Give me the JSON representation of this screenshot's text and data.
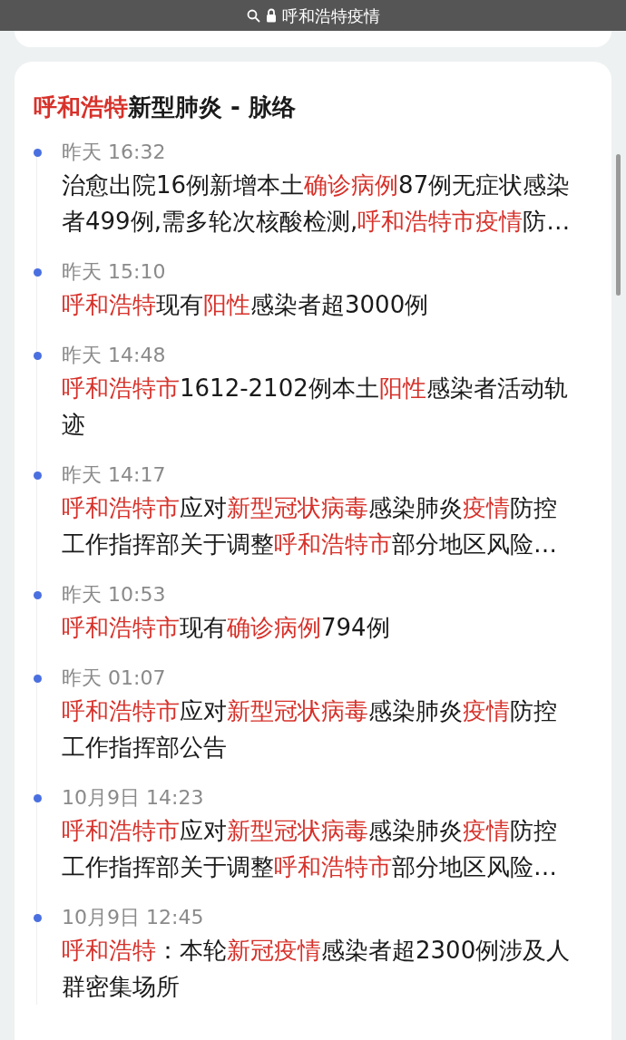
{
  "address_bar": {
    "text": "呼和浩特疫情"
  },
  "card": {
    "title": [
      {
        "t": "呼和浩特",
        "red": true
      },
      {
        "t": "新型肺炎 - 脉络",
        "red": false
      }
    ],
    "items": [
      {
        "time": "昨天 16:32",
        "lines": [
          [
            {
              "t": "治愈出院16例新增本土",
              "red": false
            },
            {
              "t": "确诊病例",
              "red": true
            },
            {
              "t": "87例无症状感染",
              "red": false
            }
          ],
          [
            {
              "t": "者499例,需多轮次核酸检测,",
              "red": false
            },
            {
              "t": "呼和浩特市疫情",
              "red": true
            },
            {
              "t": "防…",
              "red": false
            }
          ]
        ]
      },
      {
        "time": "昨天 15:10",
        "lines": [
          [
            {
              "t": "呼和浩特",
              "red": true
            },
            {
              "t": "现有",
              "red": false
            },
            {
              "t": "阳性",
              "red": true
            },
            {
              "t": "感染者超3000例",
              "red": false
            }
          ]
        ]
      },
      {
        "time": "昨天 14:48",
        "lines": [
          [
            {
              "t": "呼和浩特市",
              "red": true
            },
            {
              "t": "1612-2102例本土",
              "red": false
            },
            {
              "t": "阳性",
              "red": true
            },
            {
              "t": "感染者活动轨",
              "red": false
            }
          ],
          [
            {
              "t": "迹",
              "red": false
            }
          ]
        ]
      },
      {
        "time": "昨天 14:17",
        "lines": [
          [
            {
              "t": "呼和浩特市",
              "red": true
            },
            {
              "t": "应对",
              "red": false
            },
            {
              "t": "新型冠状病毒",
              "red": true
            },
            {
              "t": "感染肺炎",
              "red": false
            },
            {
              "t": "疫情",
              "red": true
            },
            {
              "t": "防控",
              "red": false
            }
          ],
          [
            {
              "t": "工作指挥部关于调整",
              "red": false
            },
            {
              "t": "呼和浩特市",
              "red": true
            },
            {
              "t": "部分地区风险…",
              "red": false
            }
          ]
        ]
      },
      {
        "time": "昨天 10:53",
        "lines": [
          [
            {
              "t": "呼和浩特市",
              "red": true
            },
            {
              "t": "现有",
              "red": false
            },
            {
              "t": "确诊病例",
              "red": true
            },
            {
              "t": "794例",
              "red": false
            }
          ]
        ]
      },
      {
        "time": "昨天 01:07",
        "lines": [
          [
            {
              "t": "呼和浩特市",
              "red": true
            },
            {
              "t": "应对",
              "red": false
            },
            {
              "t": "新型冠状病毒",
              "red": true
            },
            {
              "t": "感染肺炎",
              "red": false
            },
            {
              "t": "疫情",
              "red": true
            },
            {
              "t": "防控",
              "red": false
            }
          ],
          [
            {
              "t": "工作指挥部公告",
              "red": false
            }
          ]
        ]
      },
      {
        "time": "10月9日 14:23",
        "lines": [
          [
            {
              "t": "呼和浩特市",
              "red": true
            },
            {
              "t": "应对",
              "red": false
            },
            {
              "t": "新型冠状病毒",
              "red": true
            },
            {
              "t": "感染肺炎",
              "red": false
            },
            {
              "t": "疫情",
              "red": true
            },
            {
              "t": "防控",
              "red": false
            }
          ],
          [
            {
              "t": "工作指挥部关于调整",
              "red": false
            },
            {
              "t": "呼和浩特市",
              "red": true
            },
            {
              "t": "部分地区风险…",
              "red": false
            }
          ]
        ]
      },
      {
        "time": "10月9日 12:45",
        "lines": [
          [
            {
              "t": "呼和浩特",
              "red": true
            },
            {
              "t": "：本轮",
              "red": false
            },
            {
              "t": "新冠疫情",
              "red": true
            },
            {
              "t": "感染者超2300例涉及人",
              "red": false
            }
          ],
          [
            {
              "t": "群密集场所",
              "red": false
            }
          ]
        ]
      }
    ]
  }
}
